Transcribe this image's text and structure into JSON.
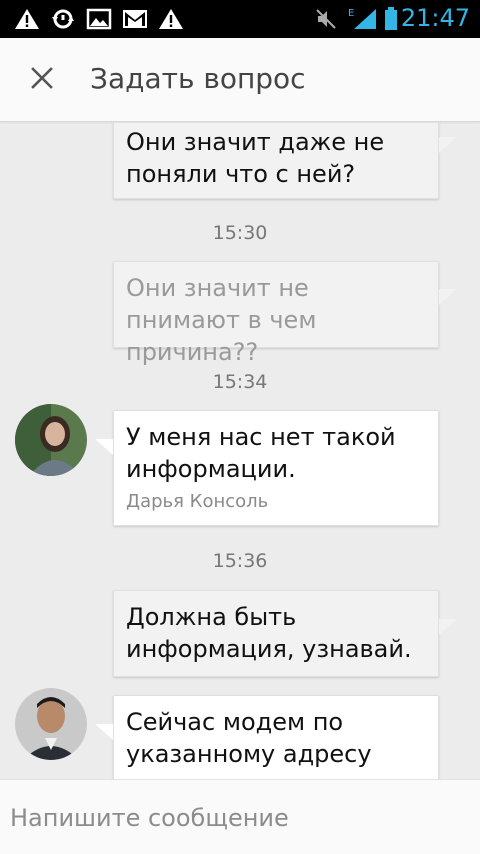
{
  "status_bar": {
    "icons": [
      "warning-icon",
      "sync-icon",
      "image-icon",
      "gmail-icon",
      "warning-icon",
      "mute-icon",
      "signal-icon",
      "battery-icon"
    ],
    "network_type": "E",
    "time": "21:47",
    "accent_color": "#33b5e5"
  },
  "header": {
    "title": "Задать вопрос",
    "close_icon": "close-icon"
  },
  "messages": [
    {
      "direction": "outgoing",
      "text": "Они значит даже не поняли что с ней?"
    },
    {
      "type": "time",
      "text": "15:30"
    },
    {
      "direction": "outgoing",
      "status": "pending",
      "text": "Они значит не пнимают в чем причина??"
    },
    {
      "type": "time",
      "text": "15:34"
    },
    {
      "direction": "incoming",
      "text": "У меня нас нет такой информации.",
      "sender": "Дарья Консоль"
    },
    {
      "type": "time",
      "text": "15:36"
    },
    {
      "direction": "outgoing",
      "text": "Должна быть информация, узнавай."
    },
    {
      "direction": "incoming",
      "text": "Сейчас модем по указанному адресу"
    }
  ],
  "input": {
    "placeholder": "Напишите сообщение"
  }
}
